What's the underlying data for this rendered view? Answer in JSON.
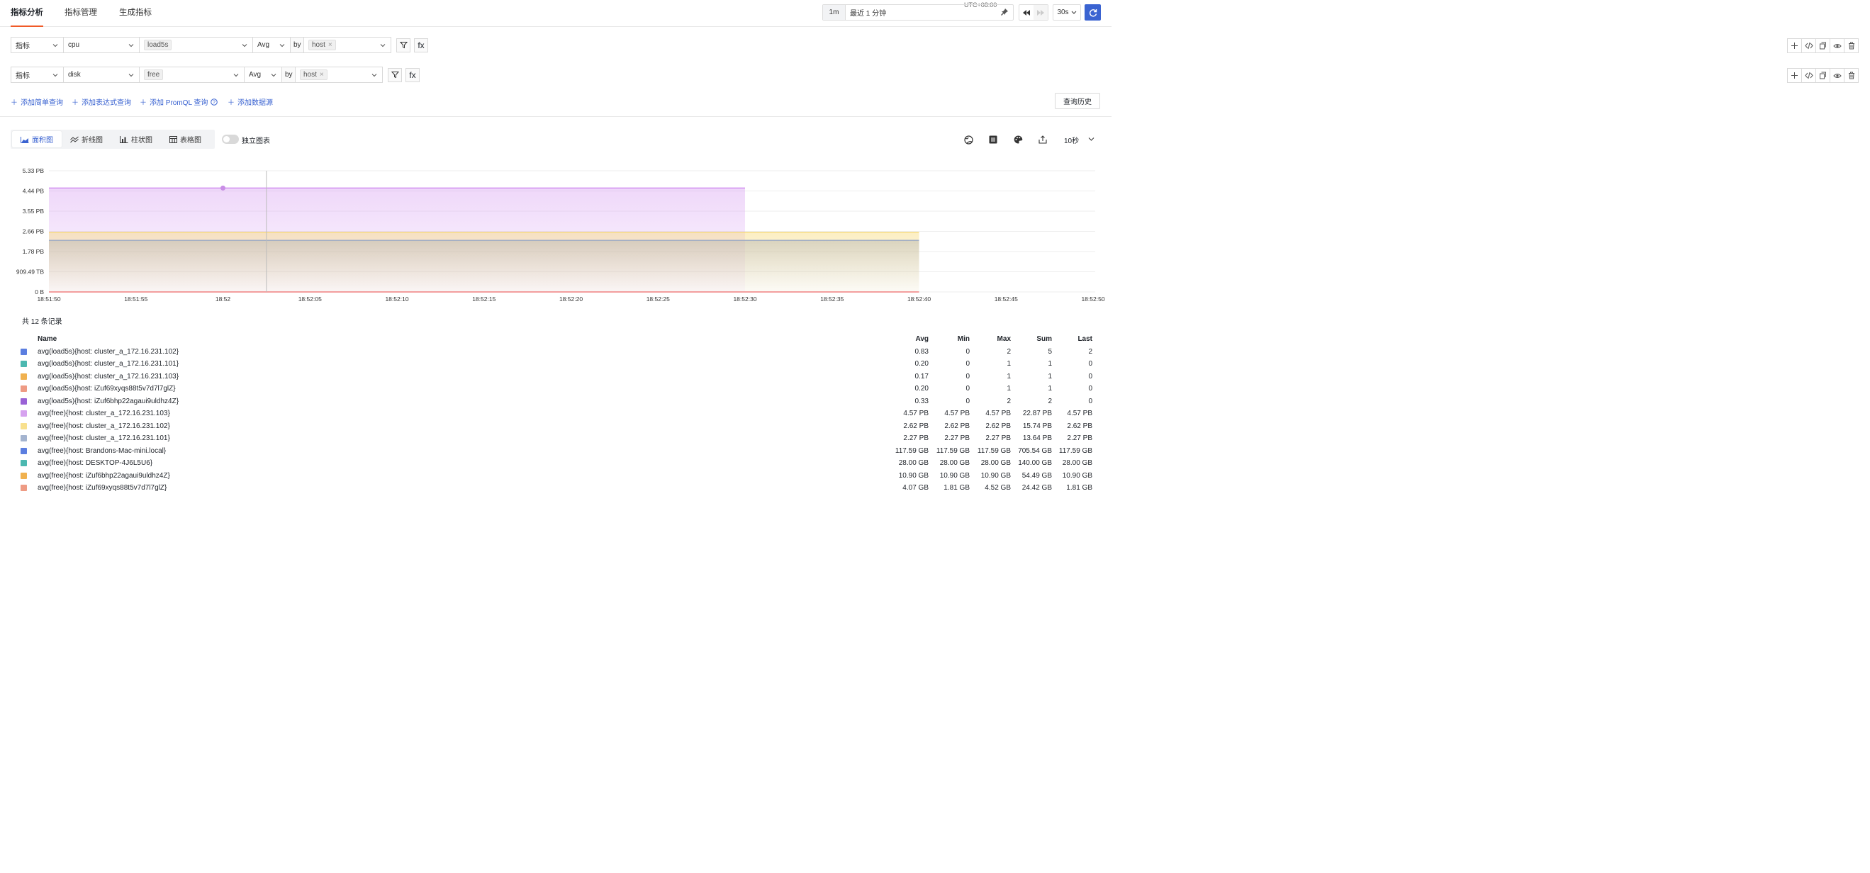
{
  "tabs": [
    {
      "label": "指标分析",
      "active": true
    },
    {
      "label": "指标管理",
      "active": false
    },
    {
      "label": "生成指标",
      "active": false
    }
  ],
  "time": {
    "utc": "UTC+08:00",
    "shortcut": "1m",
    "range": "最近 1 分钟",
    "refresh": "30s"
  },
  "queries": [
    {
      "type": "指标",
      "measurement": "cpu",
      "field": "load5s",
      "agg": "Avg",
      "by": "by",
      "group": "host"
    },
    {
      "type": "指标",
      "measurement": "disk",
      "field": "free",
      "agg": "Avg",
      "by": "by",
      "group": "host"
    }
  ],
  "fx_label": "fx",
  "add_links": {
    "simple": "添加简单查询",
    "expr": "添加表达式查询",
    "promql": "添加 PromQL 查询",
    "datasource": "添加数据源"
  },
  "history_button": "查询历史",
  "view_tabs": [
    {
      "label": "面积图",
      "icon": "area-chart-icon",
      "active": true
    },
    {
      "label": "折线图",
      "icon": "line-chart-icon",
      "active": false
    },
    {
      "label": "柱状图",
      "icon": "bar-chart-icon",
      "active": false
    },
    {
      "label": "表格图",
      "icon": "table-icon",
      "active": false
    }
  ],
  "standalone_label": "独立图表",
  "interval": "10秒",
  "chart_data": {
    "type": "area",
    "y_ticks": [
      "0 B",
      "909.49 TB",
      "1.78 PB",
      "2.66 PB",
      "3.55 PB",
      "4.44 PB",
      "5.33 PB"
    ],
    "x_ticks": [
      "18:51:50",
      "18:51:55",
      "18:52",
      "18:52:05",
      "18:52:10",
      "18:52:15",
      "18:52:20",
      "18:52:25",
      "18:52:30",
      "18:52:35",
      "18:52:40",
      "18:52:45",
      "18:52:50"
    ],
    "ylim_pb": [
      0,
      5.33
    ],
    "grid": true,
    "cursor_time": "18:52:02.5",
    "series": [
      {
        "name": "avg(free){host: cluster_a_172.16.231.103}",
        "color": "#d18ff0",
        "value_pb": 4.57,
        "start": "18:51:50",
        "end": "18:52:30"
      },
      {
        "name": "avg(free){host: cluster_a_172.16.231.102}",
        "color": "#f7da7a",
        "value_pb": 2.62,
        "start": "18:51:50",
        "end": "18:52:40"
      },
      {
        "name": "avg(free){host: cluster_a_172.16.231.101}",
        "color": "#9aa9c4",
        "value_pb": 2.27,
        "start": "18:51:50",
        "end": "18:52:40"
      },
      {
        "name": "avg(load5s)",
        "color": "#f08080",
        "value_pb": 0,
        "start": "18:51:50",
        "end": "18:52:40"
      }
    ]
  },
  "legend": {
    "count_text": "共 12 条记录",
    "headers": {
      "name": "Name",
      "avg": "Avg",
      "min": "Min",
      "max": "Max",
      "sum": "Sum",
      "last": "Last"
    },
    "rows": [
      {
        "color": "#5b7ee0",
        "name": "avg(load5s){host: cluster_a_172.16.231.102}",
        "avg": "0.83",
        "min": "0",
        "max": "2",
        "sum": "5",
        "last": "2"
      },
      {
        "color": "#4cb8b0",
        "name": "avg(load5s){host: cluster_a_172.16.231.101}",
        "avg": "0.20",
        "min": "0",
        "max": "1",
        "sum": "1",
        "last": "0"
      },
      {
        "color": "#f0b14f",
        "name": "avg(load5s){host: cluster_a_172.16.231.103}",
        "avg": "0.17",
        "min": "0",
        "max": "1",
        "sum": "1",
        "last": "0"
      },
      {
        "color": "#ee9b84",
        "name": "avg(load5s){host: iZuf69xyqs88t5v7d7l7glZ}",
        "avg": "0.20",
        "min": "0",
        "max": "1",
        "sum": "1",
        "last": "0"
      },
      {
        "color": "#9a62d6",
        "name": "avg(load5s){host: iZuf6bhp22agaui9uldhz4Z}",
        "avg": "0.33",
        "min": "0",
        "max": "2",
        "sum": "2",
        "last": "0"
      },
      {
        "color": "#d6a2ef",
        "name": "avg(free){host: cluster_a_172.16.231.103}",
        "avg": "4.57 PB",
        "min": "4.57 PB",
        "max": "4.57 PB",
        "sum": "22.87 PB",
        "last": "4.57 PB"
      },
      {
        "color": "#f8e08e",
        "name": "avg(free){host: cluster_a_172.16.231.102}",
        "avg": "2.62 PB",
        "min": "2.62 PB",
        "max": "2.62 PB",
        "sum": "15.74 PB",
        "last": "2.62 PB"
      },
      {
        "color": "#a4b4cf",
        "name": "avg(free){host: cluster_a_172.16.231.101}",
        "avg": "2.27 PB",
        "min": "2.27 PB",
        "max": "2.27 PB",
        "sum": "13.64 PB",
        "last": "2.27 PB"
      },
      {
        "color": "#5b7ee0",
        "name": "avg(free){host: Brandons-Mac-mini.local}",
        "avg": "117.59 GB",
        "min": "117.59 GB",
        "max": "117.59 GB",
        "sum": "705.54 GB",
        "last": "117.59 GB"
      },
      {
        "color": "#4cb8b0",
        "name": "avg(free){host: DESKTOP-4J6L5U6}",
        "avg": "28.00 GB",
        "min": "28.00 GB",
        "max": "28.00 GB",
        "sum": "140.00 GB",
        "last": "28.00 GB"
      },
      {
        "color": "#f0b14f",
        "name": "avg(free){host: iZuf6bhp22agaui9uldhz4Z}",
        "avg": "10.90 GB",
        "min": "10.90 GB",
        "max": "10.90 GB",
        "sum": "54.49 GB",
        "last": "10.90 GB"
      },
      {
        "color": "#ee9b84",
        "name": "avg(free){host: iZuf69xyqs88t5v7d7l7glZ}",
        "avg": "4.07 GB",
        "min": "1.81 GB",
        "max": "4.52 GB",
        "sum": "24.42 GB",
        "last": "1.81 GB"
      }
    ]
  }
}
